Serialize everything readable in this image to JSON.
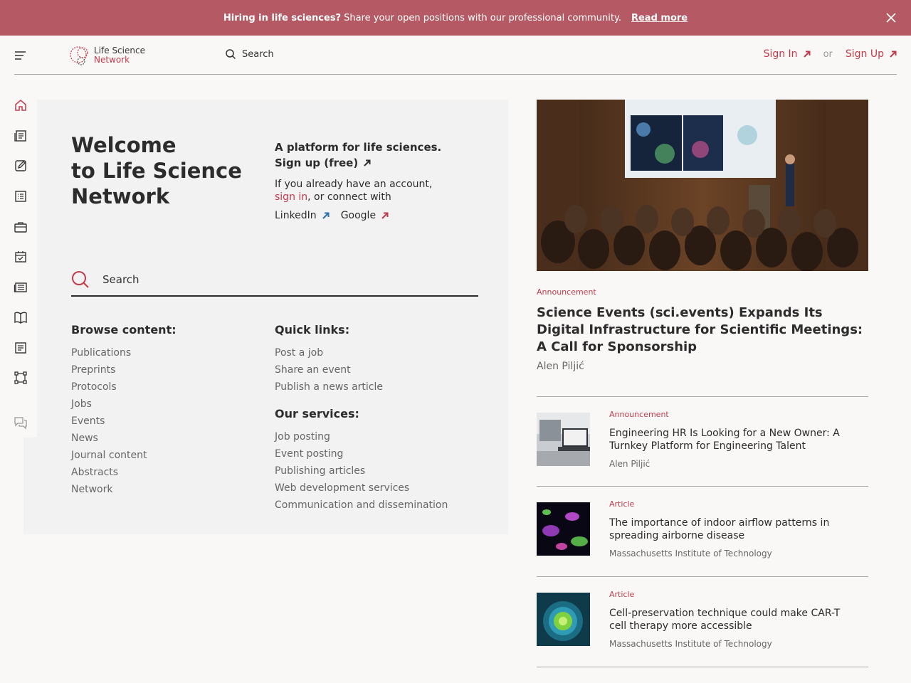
{
  "banner": {
    "bold": "Hiring in life sciences?",
    "text": "Share your open positions with our professional community.",
    "link": "Read more"
  },
  "header": {
    "logo_line1": "Life Science",
    "logo_line2": "Network",
    "search_label": "Search",
    "sign_in": "Sign In",
    "or": "or",
    "sign_up": "Sign Up"
  },
  "welcome": {
    "line1": "Welcome",
    "line2": "to Life Science",
    "line3": "Network",
    "platform_title": "A platform for life sciences.",
    "signup_free": "Sign up (free)",
    "already_prefix": "If you already have an account,",
    "sign_in_link": "sign in",
    "already_suffix": ", or connect with",
    "linkedin": "LinkedIn",
    "google": "Google",
    "search_placeholder": "Search"
  },
  "browse": {
    "title": "Browse content:",
    "items": [
      "Publications",
      "Preprints",
      "Protocols",
      "Jobs",
      "Events",
      "News",
      "Journal content",
      "Abstracts",
      "Network"
    ]
  },
  "quick": {
    "title": "Quick links:",
    "items": [
      "Post a job",
      "Share an event",
      "Publish a news article"
    ]
  },
  "services": {
    "title": "Our services:",
    "items": [
      "Job posting",
      "Event posting",
      "Publishing articles",
      "Web development services",
      "Communication and dissemination"
    ]
  },
  "featured": {
    "category": "Announcement",
    "title": "Science Events (sci.events) Expands Its Digital Infrastructure for Scientific Meetings: A Call for Sponsorship",
    "author": "Alen Piljić"
  },
  "news": [
    {
      "category": "Announcement",
      "title": "Engineering HR Is Looking for a New Owner: A Turnkey Platform for Engineering Talent",
      "author": "Alen Piljić"
    },
    {
      "category": "Article",
      "title": "The importance of indoor airflow patterns in spreading airborne disease",
      "author": "Massachusetts Institute of Technology"
    },
    {
      "category": "Article",
      "title": "Cell-preservation technique could make CAR-T cell therapy more accessible",
      "author": "Massachusetts Institute of Technology"
    }
  ],
  "colors": {
    "accent": "#c23b4a",
    "banner": "#b55a64",
    "link_blue": "#2a6fb0"
  },
  "sidebar_icons": [
    "home-icon",
    "news-icon",
    "edit-icon",
    "list-icon",
    "briefcase-icon",
    "calendar-icon",
    "newspaper-icon",
    "book-icon",
    "document-icon",
    "network-icon",
    "chat-icon"
  ]
}
